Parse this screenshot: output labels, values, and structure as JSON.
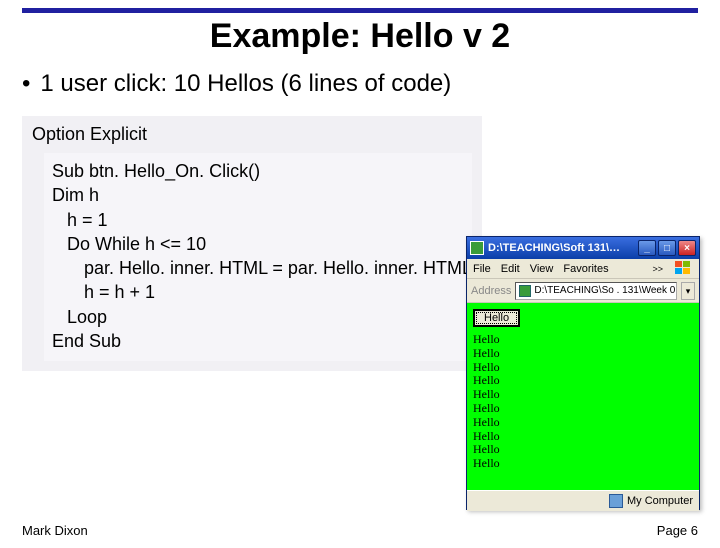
{
  "title": "Example: Hello v 2",
  "bullet": "1 user click: 10 Hellos (6 lines of code)",
  "code": {
    "outer": "Option Explicit",
    "lines": [
      "Sub btn. Hello_On. Click()",
      "Dim h",
      " h = 1",
      " Do While h <= 10",
      "  par. Hello. inner. HTML = par. Hello. inner. HTML & \"Hello",
      "  h = h + 1",
      " Loop",
      "End Sub"
    ]
  },
  "browser": {
    "title": "D:\\TEACHING\\Soft 131\\…",
    "menu": {
      "file": "File",
      "edit": "Edit",
      "view": "View",
      "favorites": "Favorites",
      "more": ">>"
    },
    "address_label": "Address",
    "address_value": "D:\\TEACHING\\So . 131\\Week 0",
    "button_label": "Hello",
    "hello_items": [
      "Hello",
      "Hello",
      "Hello",
      "Hello",
      "Hello",
      "Hello",
      "Hello",
      "Hello",
      "Hello",
      "Hello"
    ],
    "status": "My Computer"
  },
  "footer": {
    "left": "Mark Dixon",
    "right": "Page 6"
  }
}
